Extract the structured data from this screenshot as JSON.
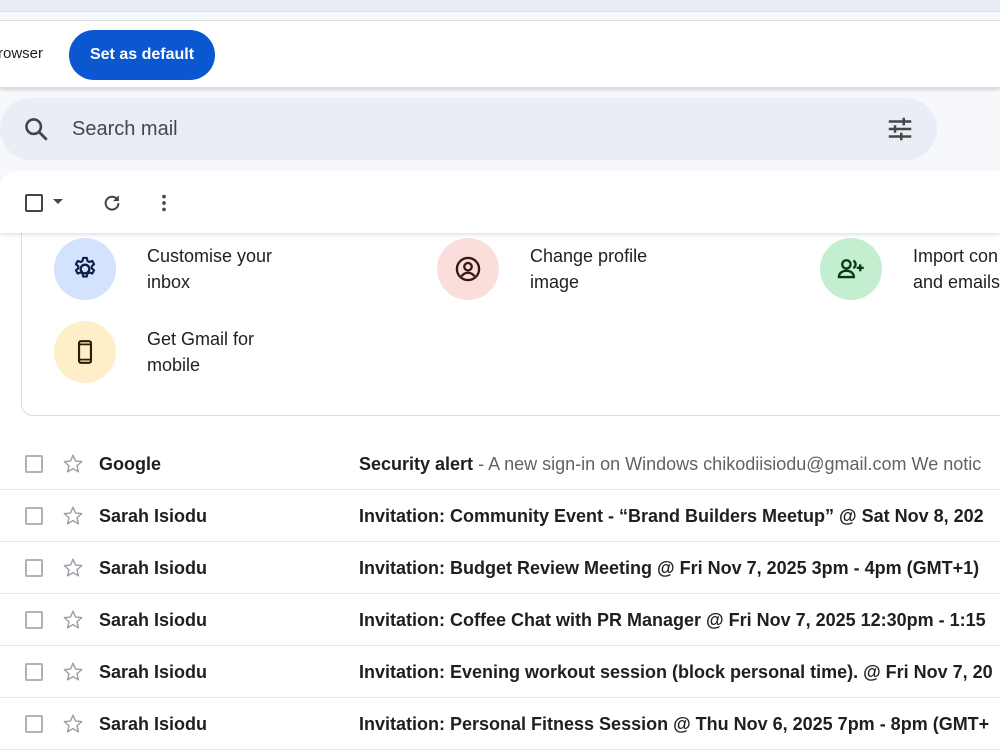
{
  "banner": {
    "text": "rowser",
    "button_label": "Set as default"
  },
  "search": {
    "placeholder": "Search mail"
  },
  "setup_tiles": [
    {
      "label": "Customise your\ninbox",
      "icon": "gear-icon",
      "color": "#d3e3fd"
    },
    {
      "label": "Change profile\nimage",
      "icon": "account-circle-icon",
      "color": "#f9dedc"
    },
    {
      "label": "Import con\nand emails",
      "icon": "add-person-icon",
      "color": "#c4eed0"
    },
    {
      "label": "Get Gmail for\nmobile",
      "icon": "smartphone-icon",
      "color": "#ffefc9"
    }
  ],
  "emails": [
    {
      "sender": "Google",
      "subject": "Security alert",
      "snippet": "A new sign-in on Windows chikodiisiodu@gmail.com We notic"
    },
    {
      "sender": "Sarah Isiodu",
      "subject": "Invitation: Community Event - “Brand Builders Meetup” @ Sat Nov 8, 202",
      "snippet": ""
    },
    {
      "sender": "Sarah Isiodu",
      "subject": "Invitation: Budget Review Meeting @ Fri Nov 7, 2025 3pm - 4pm (GMT+1)",
      "snippet": ""
    },
    {
      "sender": "Sarah Isiodu",
      "subject": "Invitation: Coffee Chat with PR Manager @ Fri Nov 7, 2025 12:30pm - 1:15",
      "snippet": ""
    },
    {
      "sender": "Sarah Isiodu",
      "subject": "Invitation: Evening workout session (block personal time). @ Fri Nov 7, 20",
      "snippet": ""
    },
    {
      "sender": "Sarah Isiodu",
      "subject": "Invitation: Personal Fitness Session @ Thu Nov 6, 2025 7pm - 8pm (GMT+",
      "snippet": ""
    }
  ],
  "colors": {
    "accent": "#0b57d0",
    "search_bg": "#e9eef6",
    "page_bg": "#f6f8fc"
  }
}
